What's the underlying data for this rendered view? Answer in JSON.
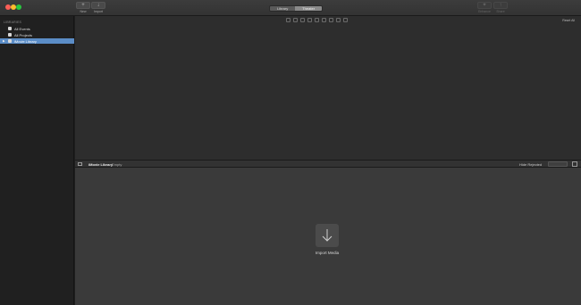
{
  "toolbar": {
    "new_label": "New",
    "import_label": "Import",
    "tabs": [
      "Library",
      "Theater"
    ],
    "enhance_label": "Enhance",
    "share_label": "Share"
  },
  "sidebar": {
    "header": "LIBRARIES",
    "items": [
      {
        "label": "All Events"
      },
      {
        "label": "All Projects"
      },
      {
        "label": "iMovie Library"
      }
    ]
  },
  "viewer": {
    "reset_all": "Reset All"
  },
  "browser_bar": {
    "library_name": "iMovie Library",
    "filter": "Empty",
    "hide_rejected": "Hide Rejected"
  },
  "browser": {
    "import_label": "Import Media"
  }
}
